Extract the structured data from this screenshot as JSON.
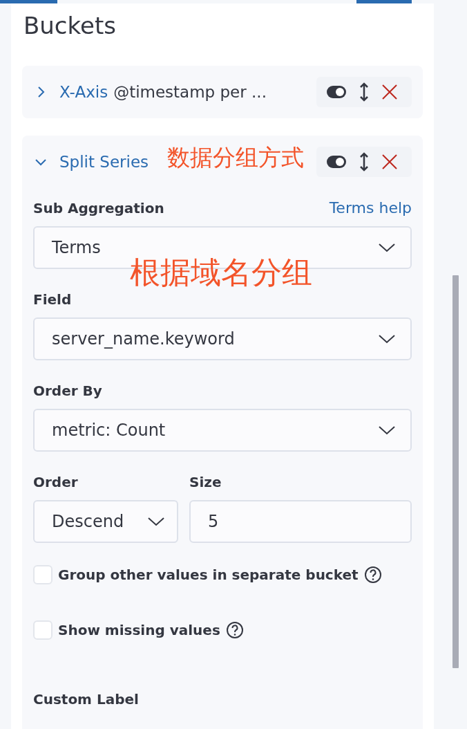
{
  "title": "Buckets",
  "aggregations": [
    {
      "type": "X-Axis",
      "description": "@timestamp per ...",
      "expanded": false
    },
    {
      "type": "Split Series",
      "expanded": true,
      "form": {
        "sub_aggregation": {
          "label": "Sub Aggregation",
          "help_link": "Terms help",
          "value": "Terms"
        },
        "field": {
          "label": "Field",
          "value": "server_name.keyword"
        },
        "order_by": {
          "label": "Order By",
          "value": "metric: Count"
        },
        "order": {
          "label": "Order",
          "value": "Descend"
        },
        "size": {
          "label": "Size",
          "value": "5"
        },
        "options": [
          {
            "label": "Group other values in separate bucket",
            "checked": false
          },
          {
            "label": "Show missing values",
            "checked": false
          }
        ],
        "custom_label": {
          "label": "Custom Label"
        }
      }
    }
  ],
  "annotations": [
    {
      "text": "数据分组方式"
    },
    {
      "text": "根据域名分组"
    }
  ]
}
